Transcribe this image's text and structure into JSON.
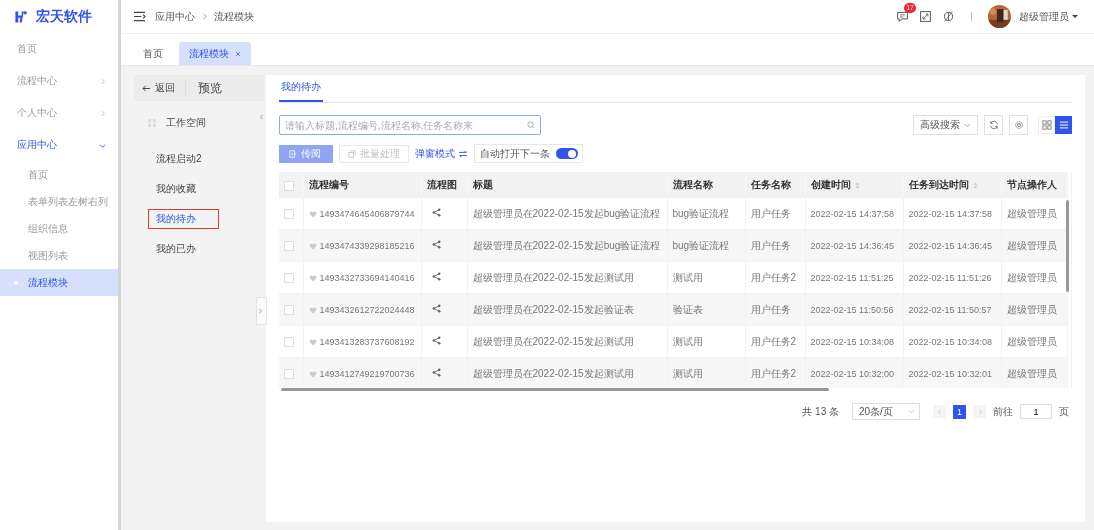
{
  "logo": {
    "text": "宏天软件"
  },
  "menu": [
    {
      "label": "首页",
      "kind": "link"
    },
    {
      "label": "流程中心",
      "kind": "group",
      "expanded": false
    },
    {
      "label": "个人中心",
      "kind": "group",
      "expanded": false
    },
    {
      "label": "应用中心",
      "kind": "group",
      "expanded": true,
      "children": [
        {
          "label": "首页",
          "selected": false
        },
        {
          "label": "表单列表左树右列",
          "selected": false
        },
        {
          "label": "组织信息",
          "selected": false
        },
        {
          "label": "视图列表",
          "selected": false
        },
        {
          "label": "流程模块",
          "selected": true
        }
      ]
    }
  ],
  "breadcrumb": [
    "应用中心",
    "流程模块"
  ],
  "header": {
    "notification_count": "17",
    "user": "超级管理员"
  },
  "tabs": [
    {
      "label": "首页",
      "selected": false,
      "closable": false
    },
    {
      "label": "流程模块",
      "selected": true,
      "closable": true
    }
  ],
  "left_panel": {
    "back": "返回",
    "title": "预览",
    "workspace": "工作空间",
    "items": [
      {
        "label": "流程启动2",
        "selected": false
      },
      {
        "label": "我的收藏",
        "selected": false
      },
      {
        "label": "我的待办",
        "selected": true
      },
      {
        "label": "我的已办",
        "selected": false
      }
    ]
  },
  "main_tabs": [
    {
      "label": "我的待办",
      "selected": true
    }
  ],
  "search": {
    "placeholder": "请输入标题,流程编号,流程名称,任务名称来"
  },
  "actions": {
    "circulate": "传阅",
    "batch": "批量处理",
    "batch_disabled": true,
    "popup_mode": "弹窗模式",
    "auto_open": {
      "label": "自动打开下一条",
      "on": true
    },
    "advanced_search": "高级搜索"
  },
  "view_modes": [
    {
      "kind": "grid",
      "selected": false
    },
    {
      "kind": "list",
      "selected": true
    }
  ],
  "table": {
    "all_checked": false,
    "columns": [
      {
        "label": "流程编号",
        "sortable": false
      },
      {
        "label": "流程图",
        "sortable": false
      },
      {
        "label": "标题",
        "sortable": false
      },
      {
        "label": "流程名称",
        "sortable": false
      },
      {
        "label": "任务名称",
        "sortable": false
      },
      {
        "label": "创建时间",
        "sortable": true
      },
      {
        "label": "任务到达时间",
        "sortable": true
      },
      {
        "label": "节点操作人",
        "sortable": false
      }
    ],
    "rows": [
      {
        "checked": false,
        "id": "1493474645406879744",
        "title": "超级管理员在2022-02-15发起bug验证流程",
        "flow_name": "bug验证流程",
        "task": "用户任务",
        "created": "2022-02-15 14:37:58",
        "arrived": "2022-02-15 14:37:58",
        "operator": "超级管理员"
      },
      {
        "checked": false,
        "id": "1493474339298185216",
        "title": "超级管理员在2022-02-15发起bug验证流程",
        "flow_name": "bug验证流程",
        "task": "用户任务",
        "created": "2022-02-15 14:36:45",
        "arrived": "2022-02-15 14:36:45",
        "operator": "超级管理员"
      },
      {
        "checked": false,
        "id": "1493432733694140416",
        "title": "超级管理员在2022-02-15发起测试用",
        "flow_name": "测试用",
        "task": "用户任务2",
        "created": "2022-02-15 11:51:25",
        "arrived": "2022-02-15 11:51:26",
        "operator": "超级管理员"
      },
      {
        "checked": false,
        "id": "1493432612722024448",
        "title": "超级管理员在2022-02-15发起验证表",
        "flow_name": "验证表",
        "task": "用户任务",
        "created": "2022-02-15 11:50:56",
        "arrived": "2022-02-15 11:50:57",
        "operator": "超级管理员"
      },
      {
        "checked": false,
        "id": "1493413283737608192",
        "title": "超级管理员在2022-02-15发起测试用",
        "flow_name": "测试用",
        "task": "用户任务2",
        "created": "2022-02-15 10:34:08",
        "arrived": "2022-02-15 10:34:08",
        "operator": "超级管理员"
      },
      {
        "checked": false,
        "id": "1493412749219700736",
        "title": "超级管理员在2022-02-15发起测试用",
        "flow_name": "测试用",
        "task": "用户任务2",
        "created": "2022-02-15 10:32:00",
        "arrived": "2022-02-15 10:32:01",
        "operator": "超级管理员"
      }
    ]
  },
  "pagination": {
    "total": "共 13 条",
    "page_size": "20条/页",
    "pages": [
      {
        "label": "1",
        "selected": true
      }
    ],
    "goto": "前往",
    "goto_value": "1",
    "page_unit": "页"
  }
}
